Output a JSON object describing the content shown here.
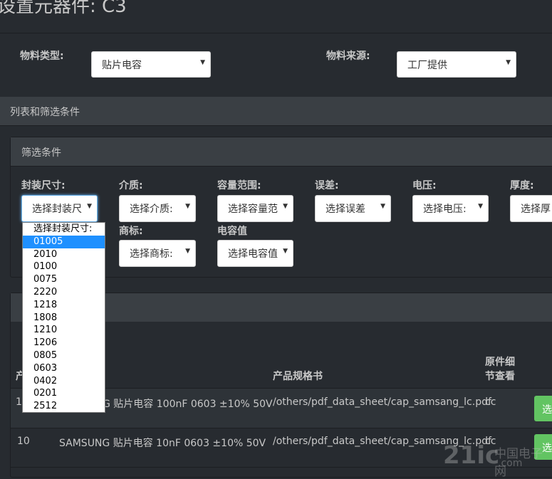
{
  "page": {
    "title": "设置元器件: C3"
  },
  "top_filters": {
    "type_label": "物料类型:",
    "type_value": "贴片电容",
    "source_label": "物料来源:",
    "source_value": "工厂提供"
  },
  "list_panel": {
    "heading": "列表和筛选条件"
  },
  "filter_panel": {
    "heading": "筛选条件",
    "fields": {
      "package": {
        "label": "封装尺寸:",
        "value": "选择封装尺"
      },
      "dielectric": {
        "label": "介质:",
        "value": "选择介质:"
      },
      "cap_range": {
        "label": "容量范围:",
        "value": "选择容量范"
      },
      "tolerance": {
        "label": "误差:",
        "value": "选择误差"
      },
      "voltage": {
        "label": "电压:",
        "value": "选择电压:"
      },
      "thickness": {
        "label": "厚度:",
        "value": "选择厚"
      },
      "brand": {
        "label": "商标:",
        "value": "选择商标:"
      },
      "cap_value": {
        "label": "电容值",
        "value": "选择电容值"
      }
    }
  },
  "package_dropdown": {
    "options": [
      "选择封装尺寸:",
      "01005",
      "2010",
      "0100",
      "0075",
      "2220",
      "1218",
      "1808",
      "1210",
      "1206",
      "0805",
      "0603",
      "0402",
      "0201",
      "2512"
    ],
    "highlighted_index": 1
  },
  "table": {
    "headers": {
      "col1": "产",
      "spec": "产品规格书",
      "detail_line1": "原件细",
      "detail_line2": "节查看"
    },
    "rows": [
      {
        "col1": "1",
        "desc": "G 贴片电容 100nF 0603 ±10% 50V",
        "pdf": "/others/pdf_data_sheet/cap_samsang_lc.pdf",
        "detail": "cc",
        "btn": "选"
      },
      {
        "col1": "10",
        "desc": "SAMSUNG 贴片电容 10nF 0603 ±10% 50V",
        "pdf": "/others/pdf_data_sheet/cap_samsang_lc.pdf",
        "detail": "cc",
        "btn": "选"
      }
    ]
  },
  "watermark": {
    "logo": "21ic",
    "cn": "中国电子网",
    "domain": ".com"
  },
  "colors": {
    "background": "#272b30",
    "panel_head": "#3a3f44",
    "highlight": "#1e90ff",
    "button_green": "#62c462"
  }
}
